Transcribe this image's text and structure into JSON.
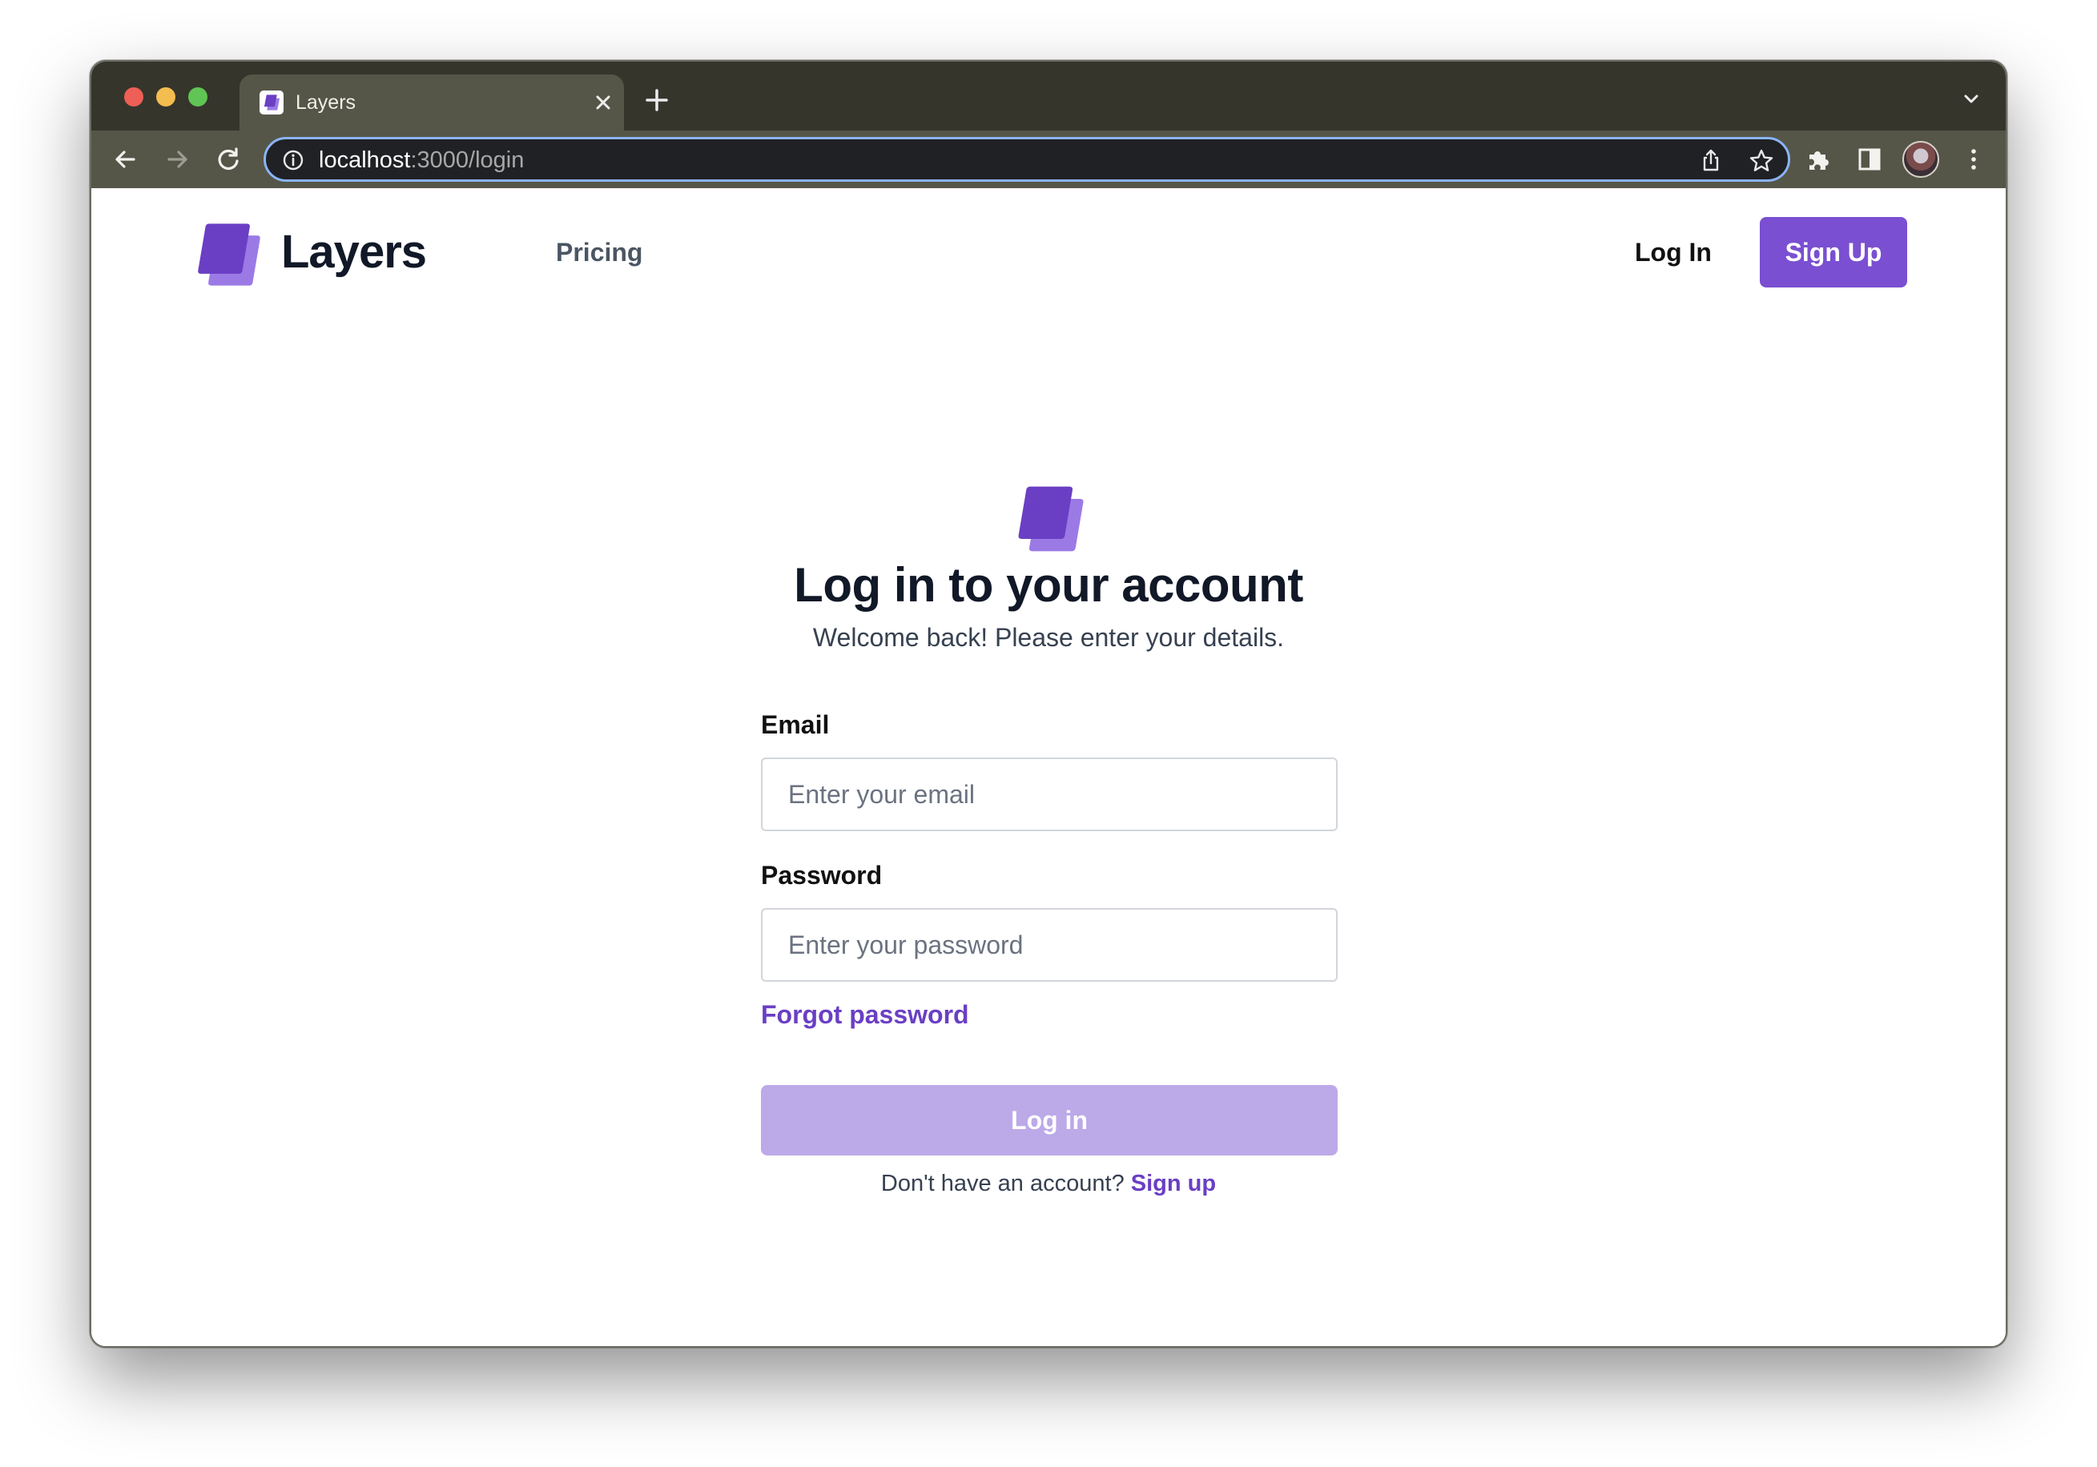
{
  "browser": {
    "tab_title": "Layers",
    "url_host": "localhost",
    "url_rest": ":3000/login"
  },
  "nav": {
    "brand": "Layers",
    "pricing": "Pricing",
    "login": "Log In",
    "signup": "Sign Up"
  },
  "form": {
    "title": "Log in to your account",
    "subtitle": "Welcome back! Please enter your details.",
    "email_label": "Email",
    "email_placeholder": "Enter your email",
    "password_label": "Password",
    "password_placeholder": "Enter your password",
    "forgot": "Forgot password",
    "submit": "Log in",
    "no_account": "Don't have an account?",
    "signup_link": "Sign up"
  },
  "colors": {
    "brand_purple": "#7a4fd1",
    "link_purple": "#6a3fc4",
    "submit_disabled": "#bca9e8"
  },
  "icons": [
    "close-icon",
    "plus-icon",
    "back-arrow-icon",
    "forward-arrow-icon",
    "reload-icon",
    "info-icon",
    "share-icon",
    "star-icon",
    "puzzle-icon",
    "sidebar-icon",
    "kebab-menu-icon",
    "chevron-down-icon",
    "layers-logo-icon"
  ]
}
